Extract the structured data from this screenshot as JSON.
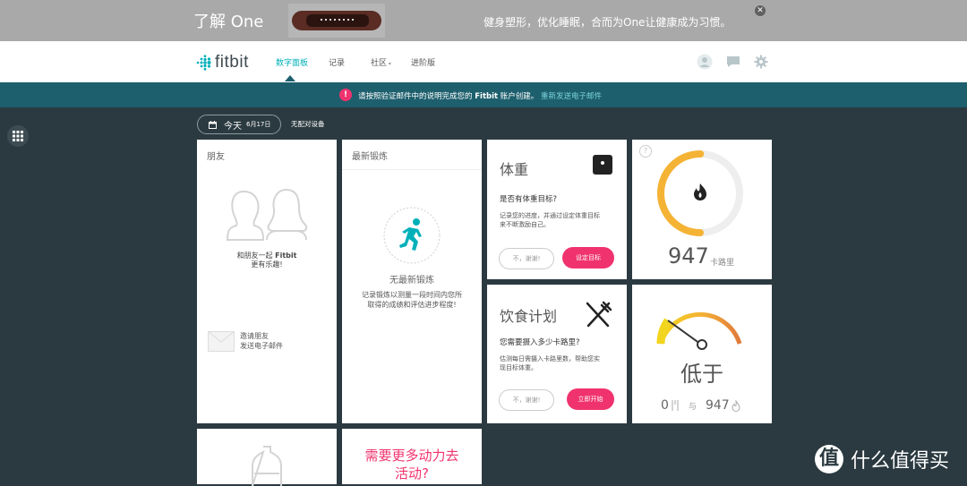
{
  "promo": {
    "title": "了解 One",
    "tagline": "健身塑形，优化睡眠，合而为One让健康成为习惯。",
    "close_icon": "close-icon"
  },
  "nav": {
    "logo": "fitbit",
    "items": [
      "数字面板",
      "记录",
      "社区",
      "进阶版"
    ],
    "active_index": 0
  },
  "alert": {
    "icon": "!",
    "prefix": "请按照验证邮件中的说明完成您的",
    "brand": "Fitbit",
    "suffix": "账户创建。",
    "link": "重新发送电子邮件"
  },
  "date": {
    "label": "今天",
    "value": "6月17日",
    "no_device": "无配对设备"
  },
  "friends": {
    "title": "朋友",
    "line1_pre": "和朋友一起",
    "line1_brand": "Fitbit",
    "line2": "更有乐趣!",
    "invite_line1": "邀请朋友",
    "invite_line2": "发送电子邮件"
  },
  "exercise": {
    "title": "最新锻炼",
    "empty_title": "无最新锻炼",
    "desc_line1": "记录锻炼以测量一段时间内您所",
    "desc_line2": "取得的成绩和评估进步程度!"
  },
  "weight": {
    "title": "体重",
    "question": "是否有体重目标?",
    "desc_line1": "记录您的进度，并通过设定体重目标",
    "desc_line2": "来不断激励自己。",
    "no_button": "不，谢谢!",
    "set_button": "设定目标"
  },
  "calories": {
    "help": "?",
    "value": "947",
    "unit": "卡路里",
    "progress": 0.5
  },
  "food": {
    "title": "饮食计划",
    "question": "您需要摄入多少卡路里?",
    "desc_line1": "估测每日需摄入卡路里数，帮助您实",
    "desc_line2": "现目标体重。",
    "no_button": "不，谢谢!",
    "start_button": "立即开始"
  },
  "balance": {
    "status": "低于",
    "in_value": "0",
    "joiner": "与",
    "out_value": "947"
  },
  "motivation": {
    "line1": "需要更多动力去",
    "line2": "活动?"
  },
  "watermark": {
    "mark": "值",
    "text": "什么值得买"
  },
  "colors": {
    "teal": "#00b0b9",
    "alert_bg": "#1d5f6d",
    "pink": "#f0336e",
    "dark_bg": "#2b3a40",
    "gauge_orange": "#f5b335"
  }
}
